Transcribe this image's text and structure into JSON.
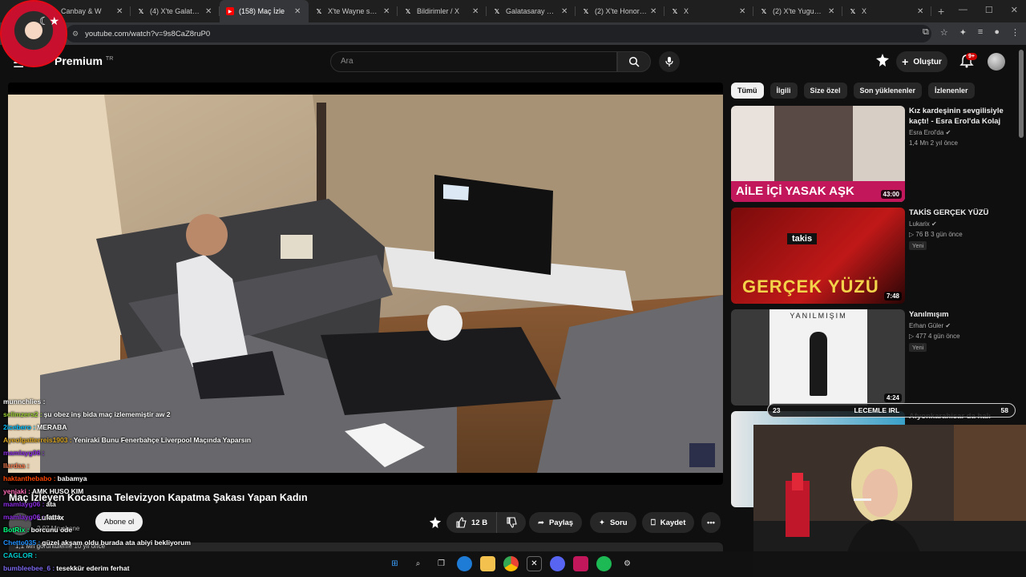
{
  "browser": {
    "tabs": [
      {
        "label": "Canbay & W",
        "icon": "x-icon",
        "active": false
      },
      {
        "label": "(4) X'te Galatasaray",
        "icon": "x-icon",
        "active": false
      },
      {
        "label": "(158) Maç İzle",
        "icon": "youtube-icon",
        "active": true
      },
      {
        "label": "X'te Wayne ss: \"o...",
        "icon": "x-icon",
        "active": false
      },
      {
        "label": "Bildirimler / X",
        "icon": "x-icon",
        "active": false
      },
      {
        "label": "Galatasaray SK (@",
        "icon": "x-icon",
        "active": false
      },
      {
        "label": "(2) X'te Honorede",
        "icon": "x-icon",
        "active": false
      },
      {
        "label": "X",
        "icon": "x-icon",
        "active": false
      },
      {
        "label": "(2) X'te Yugusugu",
        "icon": "x-icon",
        "active": false
      },
      {
        "label": "X",
        "icon": "x-icon",
        "active": false
      }
    ],
    "new_tab": "+",
    "url": "youtube.com/watch?v=9s8CaZ8ruP0"
  },
  "youtube": {
    "logo_text": "Premium",
    "logo_region": "TR",
    "search_placeholder": "Ara",
    "create_label": "Oluştur",
    "notifications_badge": "9+"
  },
  "video": {
    "title": "Maç İzleyen Kocasına Televizyon Kapatma Şakası Yapan Kadın",
    "channel_name": "Lukarix",
    "channel_subs": "2,07 Mn abone",
    "subscribe_label": "Abone ol",
    "likes": "12 B",
    "share_label": "Paylaş",
    "ask_label": "Soru",
    "save_label": "Kaydet",
    "description_preview": "1,1 Mn görüntüleme  10 yıl önce"
  },
  "chat": [
    {
      "user": "munnchlies :",
      "msg": "",
      "color": "#ffffff"
    },
    {
      "user": "selimzers2 :",
      "msg": "şu obez inş bida maç izlememiştir aw 2",
      "color": "#9acd32"
    },
    {
      "user": "2icebero :",
      "msg": "MERABA",
      "color": "#00bfff"
    },
    {
      "user": "Ayeolgatterreis1903 :",
      "msg": "Yeniraki Bunu Fenerbahçe Liverpool Maçında Yaparsın",
      "color": "#daa520"
    },
    {
      "user": "mamlayg06 :",
      "msg": "",
      "color": "#8a2be2"
    },
    {
      "user": "llardaa :",
      "msg": "",
      "color": "#ff7f50"
    },
    {
      "user": "haktanthebabo :",
      "msg": "babamya",
      "color": "#ff4500"
    },
    {
      "user": "yenjaki :",
      "msg": "AMK HUSO KIM",
      "color": "#ff69b4"
    },
    {
      "user": "mamlayg06 :",
      "msg": "ata",
      "color": "#8a2be2"
    },
    {
      "user": "mamlayg06 :",
      "msg": "fatta",
      "color": "#8a2be2"
    },
    {
      "user": "BotRix :",
      "msg": "borcunu öde",
      "color": "#00ff7f"
    },
    {
      "user": "Chetto035 :",
      "msg": "güzel akşam oldu burada ata abiyi bekliyorum",
      "color": "#1e90ff"
    },
    {
      "user": "CAGLOR :",
      "msg": "",
      "color": "#00ced1"
    },
    {
      "user": "bumbleebee_6 :",
      "msg": "tesekkür ederim ferhat",
      "color": "#7b68ee"
    }
  ],
  "chips": [
    "Tümü",
    "İlgili",
    "Size özel",
    "Son yüklenenler",
    "İzlenenler"
  ],
  "recommendations": [
    {
      "title": "Kız kardeşinin sevgilisiyle kaçtı! - Esra Erol'da Kolaj",
      "channel": "Esra Erol'da",
      "meta": "1,4 Mn  2 yıl önce",
      "duration": "43:00",
      "thumb_text": "AİLE İÇİ YASAK AŞK",
      "new": ""
    },
    {
      "title": "TAKİS GERÇEK YÜZÜ",
      "channel": "Lukarix",
      "meta": "76 B  3 gün önce",
      "duration": "7:48",
      "thumb_text": "GERÇEK YÜZÜ",
      "thumb_tag": "takis",
      "new": "Yeni"
    },
    {
      "title": "Yanılmışım",
      "channel": "Erhan Güler",
      "meta": "477  4 gün önce",
      "duration": "4:24",
      "thumb_text": "YANILMIŞIM",
      "new": "Yeni"
    },
    {
      "title": "Afyonkarahisar da halı",
      "channel": "",
      "meta": "",
      "duration": "",
      "thumb_text": "",
      "new": ""
    }
  ],
  "overlay": {
    "irl_left": "23",
    "irl_text": "LECEMLE IRL",
    "irl_right": "58"
  },
  "colors": {
    "youtube_red": "#ff0000",
    "background": "#0f0f0f",
    "chip_active": "#f1f1f1"
  }
}
